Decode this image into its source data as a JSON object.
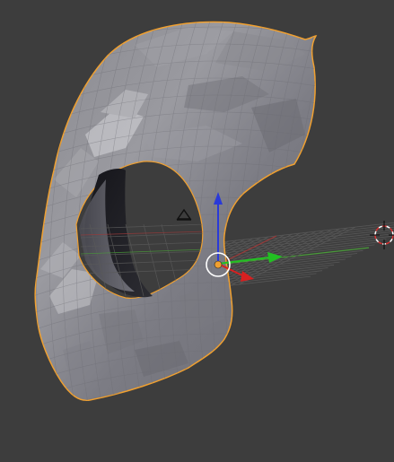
{
  "viewport": {
    "background": "#3d3d3d",
    "mode": "3D viewport"
  },
  "scene": {
    "selected_object": {
      "shape": "hollow head mesh",
      "fill": "#8d8d93",
      "outline_color": "#f0a030",
      "shading": "faceted"
    },
    "grid": {
      "line_color": "#575757",
      "x_axis_color": "#9a3a3a",
      "y_axis_color": "#4a9a3a"
    },
    "gizmo": {
      "z_arrow_color": "#2a3ad8",
      "y_arrow_color": "#22c022",
      "x_arrow_color": "#d82020",
      "pivot_color": "#f0a030",
      "ring_color": "#ffffff"
    },
    "lamp": {
      "icon": "lamp-icon"
    },
    "cursor_3d": {
      "icon": "3d-cursor-icon",
      "ring_color": "#d83030"
    }
  }
}
